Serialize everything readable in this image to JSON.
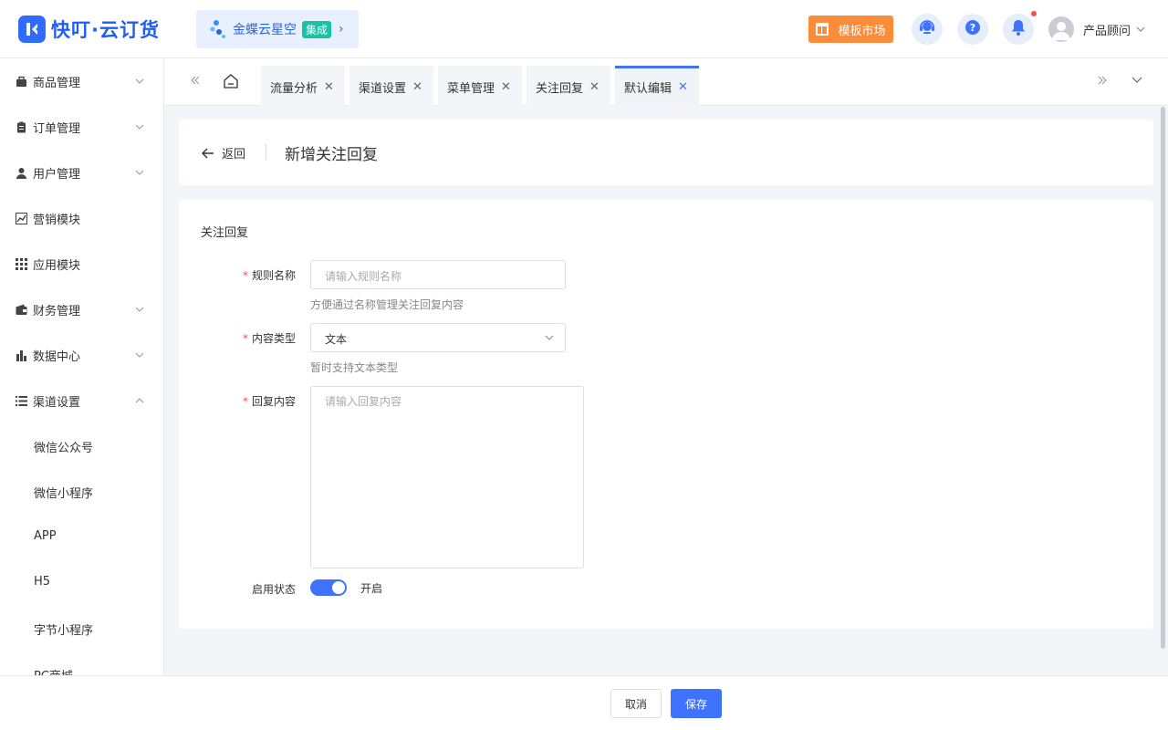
{
  "header": {
    "logo_text": "快叮·云订货",
    "integration_label": "金蝶云星空",
    "integration_tag": "集成",
    "template_market": "模板市场",
    "user_name": "产品顾问"
  },
  "sidebar": {
    "items": [
      {
        "label": "商品管理"
      },
      {
        "label": "订单管理"
      },
      {
        "label": "用户管理"
      },
      {
        "label": "营销模块"
      },
      {
        "label": "应用模块"
      },
      {
        "label": "财务管理"
      },
      {
        "label": "数据中心"
      },
      {
        "label": "渠道设置"
      }
    ],
    "sub_items": [
      {
        "label": "微信公众号"
      },
      {
        "label": "微信小程序"
      },
      {
        "label": "APP"
      },
      {
        "label": "H5"
      },
      {
        "label": "字节小程序"
      },
      {
        "label": "PC商城"
      }
    ]
  },
  "tabs": [
    {
      "label": "流量分析"
    },
    {
      "label": "渠道设置"
    },
    {
      "label": "菜单管理"
    },
    {
      "label": "关注回复"
    },
    {
      "label": "默认编辑"
    }
  ],
  "page": {
    "back_label": "返回",
    "title": "新增关注回复",
    "section_title": "关注回复"
  },
  "form": {
    "required_mark": "*",
    "rule_name_label": "规则名称",
    "rule_name_placeholder": "请输入规则名称",
    "rule_name_hint": "方便通过名称管理关注回复内容",
    "content_type_label": "内容类型",
    "content_type_value": "文本",
    "content_type_hint": "暂时支持文本类型",
    "reply_content_label": "回复内容",
    "reply_content_placeholder": "请输入回复内容",
    "status_label": "启用状态",
    "status_value": "开启"
  },
  "footer": {
    "cancel_label": "取消",
    "save_label": "保存"
  },
  "colors": {
    "accent": "#3f73ff",
    "template_button": "#fb8c3a",
    "integration_tag": "#19c2a6",
    "notification_dot": "#ff4d4f"
  }
}
